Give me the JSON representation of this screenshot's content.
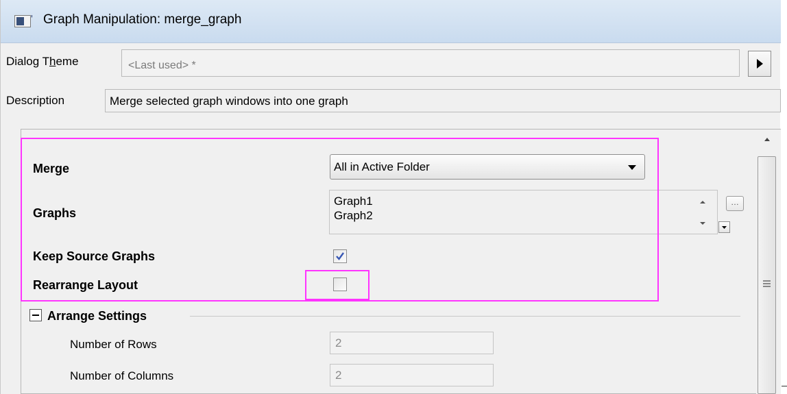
{
  "window": {
    "title": "Graph Manipulation: merge_graph"
  },
  "header": {
    "dialog_theme_label": "Dialog Theme",
    "dialog_theme_value": "<Last used> *",
    "description_label": "Description",
    "description_value": "Merge selected graph windows into one graph"
  },
  "settings": {
    "merge_label": "Merge",
    "merge_value": "All in Active Folder",
    "graphs_label": "Graphs",
    "graphs_list": [
      "Graph1",
      "Graph2"
    ],
    "keep_source_label": "Keep Source Graphs",
    "keep_source_checked": true,
    "rearrange_label": "Rearrange Layout",
    "rearrange_checked": false
  },
  "arrange": {
    "group_label": "Arrange Settings",
    "rows_label": "Number of Rows",
    "rows_value": "2",
    "cols_label": "Number of Columns",
    "cols_value": "2"
  },
  "colors": {
    "highlight": "#ff33ff",
    "titlebar": "#c9dbef",
    "check": "#3857b4"
  },
  "icons": {
    "app": "graph-window-icon",
    "theme_menu": "triangle-right-icon",
    "combo": "chevron-down-icon",
    "collapse": "minus-box-icon",
    "browse": "ellipsis-icon"
  }
}
